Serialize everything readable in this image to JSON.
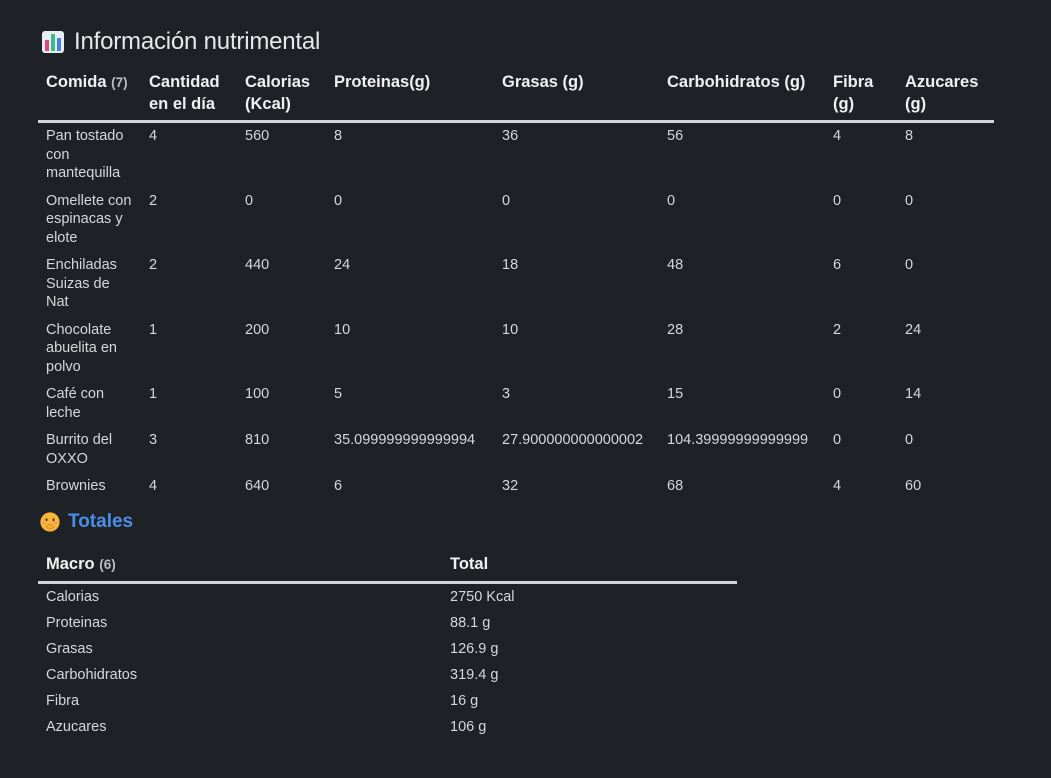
{
  "page": {
    "title": "Información nutrimental",
    "title_icon": "bar-chart-icon",
    "totals_title": "Totales",
    "totals_icon": "face-with-hand-over-mouth-icon"
  },
  "food_table": {
    "headers": {
      "comida": "Comida",
      "comida_count": "(7)",
      "cantidad": "Cantidad en el día",
      "calorias": "Calorias (Kcal)",
      "proteinas": "Proteinas(g)",
      "grasas": "Grasas (g)",
      "carbohidratos": "Carbohidratos (g)",
      "fibra": "Fibra (g)",
      "azucares": "Azucares (g)"
    },
    "rows": [
      {
        "comida": "Pan tostado con mantequilla",
        "cantidad": "4",
        "calorias": "560",
        "proteinas": "8",
        "grasas": "36",
        "carbohidratos": "56",
        "fibra": "4",
        "azucares": "8"
      },
      {
        "comida": "Omellete con espinacas y elote",
        "cantidad": "2",
        "calorias": "0",
        "proteinas": "0",
        "grasas": "0",
        "carbohidratos": "0",
        "fibra": "0",
        "azucares": "0"
      },
      {
        "comida": "Enchiladas Suizas de Nat",
        "cantidad": "2",
        "calorias": "440",
        "proteinas": "24",
        "grasas": "18",
        "carbohidratos": "48",
        "fibra": "6",
        "azucares": "0"
      },
      {
        "comida": "Chocolate abuelita en polvo",
        "cantidad": "1",
        "calorias": "200",
        "proteinas": "10",
        "grasas": "10",
        "carbohidratos": "28",
        "fibra": "2",
        "azucares": "24"
      },
      {
        "comida": "Café con leche",
        "cantidad": "1",
        "calorias": "100",
        "proteinas": "5",
        "grasas": "3",
        "carbohidratos": "15",
        "fibra": "0",
        "azucares": "14"
      },
      {
        "comida": "Burrito del OXXO",
        "cantidad": "3",
        "calorias": "810",
        "proteinas": "35.099999999999994",
        "grasas": "27.900000000000002",
        "carbohidratos": "104.39999999999999",
        "fibra": "0",
        "azucares": "0"
      },
      {
        "comida": "Brownies",
        "cantidad": "4",
        "calorias": "640",
        "proteinas": "6",
        "grasas": "32",
        "carbohidratos": "68",
        "fibra": "4",
        "azucares": "60"
      }
    ]
  },
  "totals_table": {
    "headers": {
      "macro": "Macro",
      "macro_count": "(6)",
      "total": "Total"
    },
    "rows": [
      {
        "macro": "Calorias",
        "total": "2750 Kcal"
      },
      {
        "macro": "Proteinas",
        "total": "88.1 g"
      },
      {
        "macro": "Grasas",
        "total": "126.9 g"
      },
      {
        "macro": "Carbohidratos",
        "total": "319.4 g"
      },
      {
        "macro": "Fibra",
        "total": "16 g"
      },
      {
        "macro": "Azucares",
        "total": "106 g"
      }
    ]
  }
}
